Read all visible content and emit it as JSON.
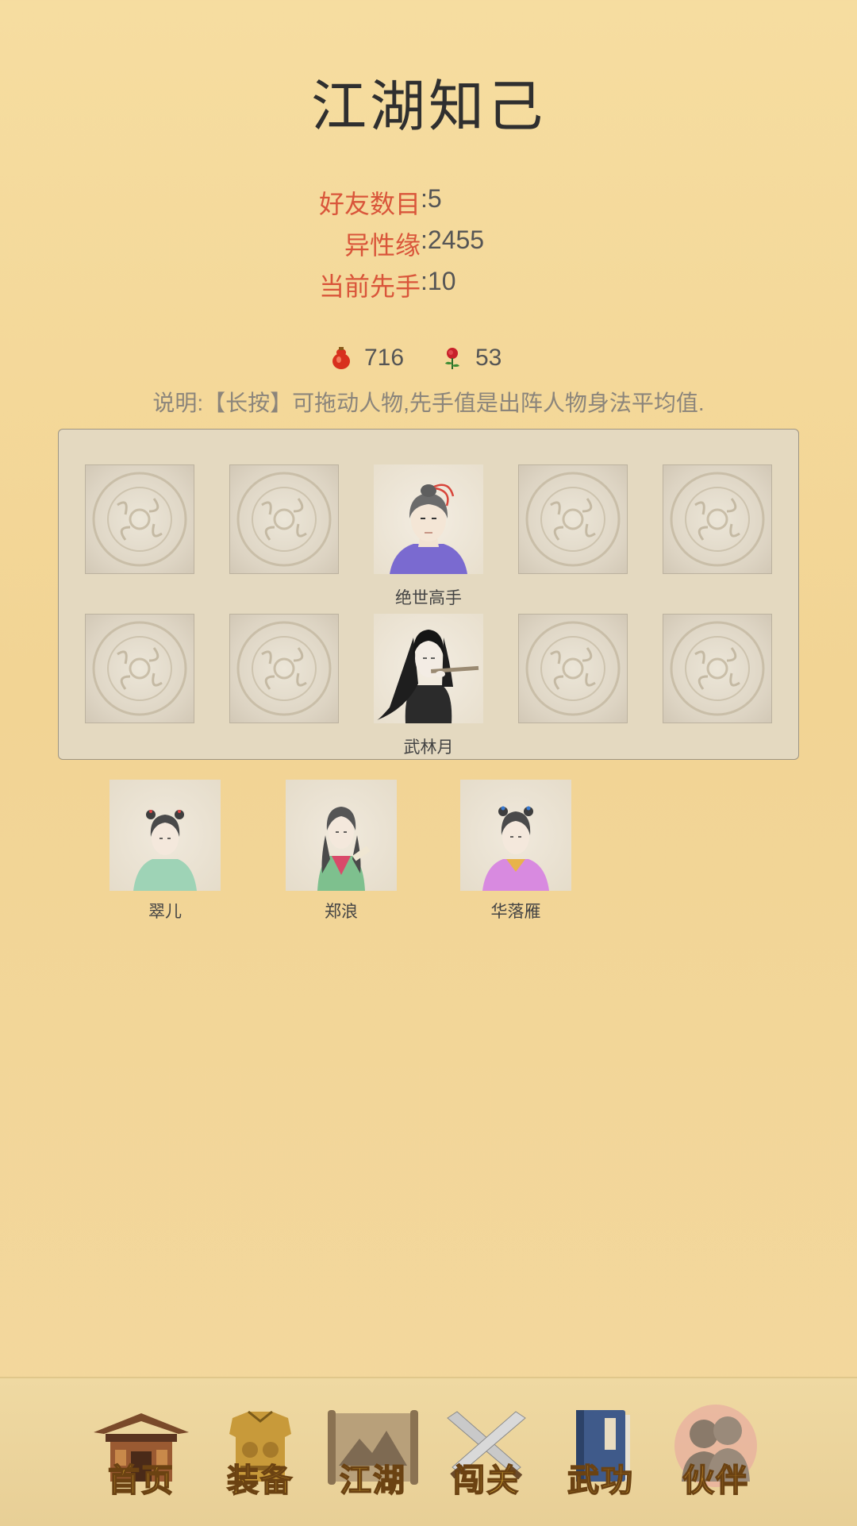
{
  "page": {
    "title": "江湖知己"
  },
  "stats": {
    "friends_label": "好友数目",
    "friends_value": "5",
    "romance_label": "异性缘",
    "romance_value": "2455",
    "initiative_label": "当前先手",
    "initiative_value": "10",
    "separator": ":"
  },
  "resources": [
    {
      "icon": "gourd-icon",
      "value": "716"
    },
    {
      "icon": "rose-icon",
      "value": "53"
    }
  ],
  "note": "说明:【长按】可拖动人物,先手值是出阵人物身法平均值.",
  "formation": {
    "row1_name": "绝世高手",
    "row2_name": "武林月"
  },
  "bench": [
    {
      "name": "翠儿"
    },
    {
      "name": "郑浪"
    },
    {
      "name": "华落雁"
    }
  ],
  "nav": [
    {
      "label": "首页",
      "icon": "pavilion-icon"
    },
    {
      "label": "装备",
      "icon": "armor-icon"
    },
    {
      "label": "江湖",
      "icon": "scroll-map-icon"
    },
    {
      "label": "闯关",
      "icon": "crossed-swords-icon"
    },
    {
      "label": "武功",
      "icon": "martial-book-icon"
    },
    {
      "label": "伙伴",
      "icon": "companions-icon",
      "active": true
    }
  ],
  "colors": {
    "accent_label": "#d9553a",
    "nav_gold": "#e6b93a",
    "background": "#f4d99c"
  }
}
